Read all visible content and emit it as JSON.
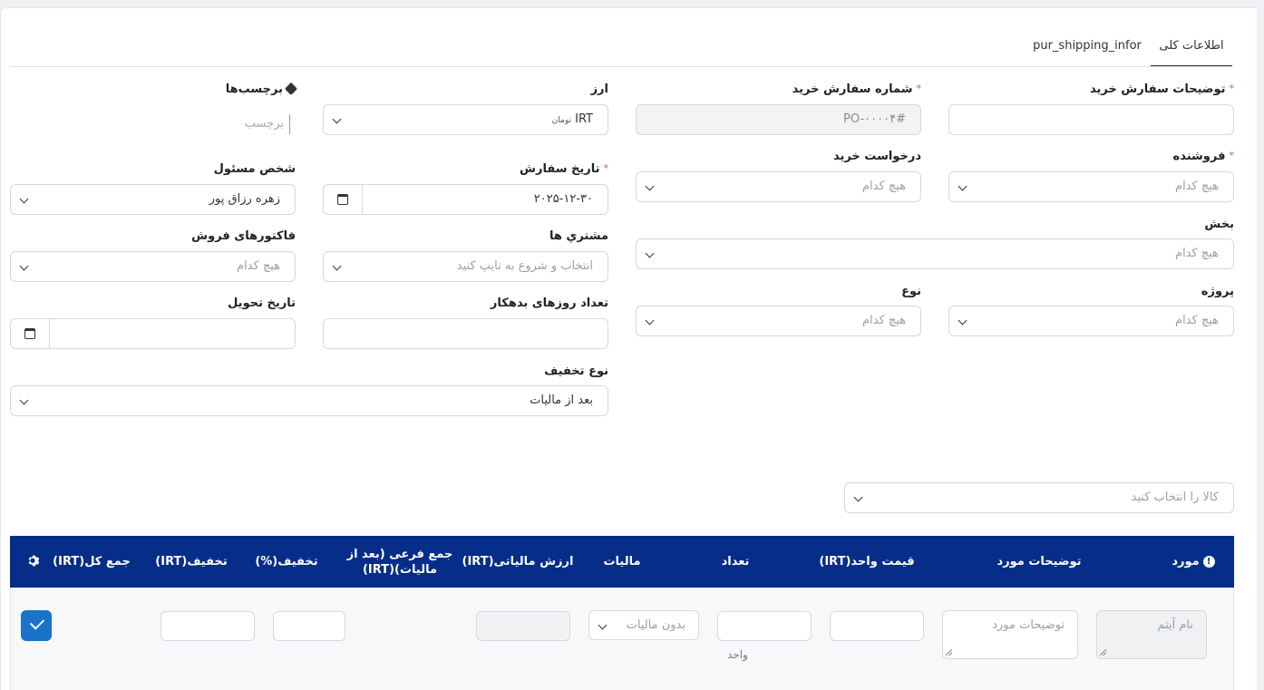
{
  "tabs": [
    {
      "label": "اطلاعات کلی",
      "active": true
    },
    {
      "label": "pur_shipping_infor",
      "active": false
    }
  ],
  "form": {
    "order_desc": {
      "label": "توضیحات سفارش خرید",
      "value": ""
    },
    "order_number": {
      "label": "شماره سفارش خرید",
      "value": "#PO-۰۰۰۰۴"
    },
    "currency": {
      "label": "ارز",
      "value": "IRT",
      "sub": "تومان"
    },
    "tags": {
      "label": "برچسب‌ها",
      "placeholder": "برچسب"
    },
    "vendor": {
      "label": "فروشنده",
      "placeholder": "هیچ کدام"
    },
    "purchase_request": {
      "label": "درخواست خرید",
      "placeholder": "هیچ کدام"
    },
    "order_date": {
      "label": "تاریخ سفارش",
      "value": "۲۰۲۵-۱۲-۳۰"
    },
    "responsible": {
      "label": "شخص مسئول",
      "value": "زهره رزاق پور"
    },
    "department": {
      "label": "بخش",
      "placeholder": "هیچ کدام"
    },
    "customers": {
      "label": "مشتري ها",
      "placeholder": "انتخاب و شروع به تایپ کنید"
    },
    "sales_invoices": {
      "label": "فاکتورهای فروش",
      "placeholder": "هیچ کدام"
    },
    "project": {
      "label": "پروژه",
      "placeholder": "هیچ کدام"
    },
    "type": {
      "label": "نوع",
      "placeholder": "هیچ کدام"
    },
    "credit_days": {
      "label": "تعداد روزهای بدهکار",
      "value": ""
    },
    "delivery_date": {
      "label": "تاریخ تحویل",
      "value": ""
    },
    "discount_type": {
      "label": "نوع تخفیف",
      "value": "بعد از مالیات"
    }
  },
  "item_select": {
    "placeholder": "کالا را انتخاب کنید"
  },
  "table": {
    "headers": {
      "item": "مورد",
      "item_desc": "توضیحات مورد",
      "unit_price": "قیمت واحد(IRT)",
      "qty": "تعداد",
      "tax": "مالیات",
      "tax_value": "ارزش مالیاتی(IRT)",
      "subtotal": "جمع فرعی (بعد از مالیات)(IRT)",
      "discount_pct": "تخفیف(%)",
      "discount_irt": "تخفیف(IRT)",
      "total": "جمع کل(IRT)"
    },
    "row": {
      "item_name_placeholder": "نام آیتم",
      "item_desc_placeholder": "توضیحات مورد",
      "tax_placeholder": "بدون مالیات",
      "unit_label": "واحد"
    }
  }
}
